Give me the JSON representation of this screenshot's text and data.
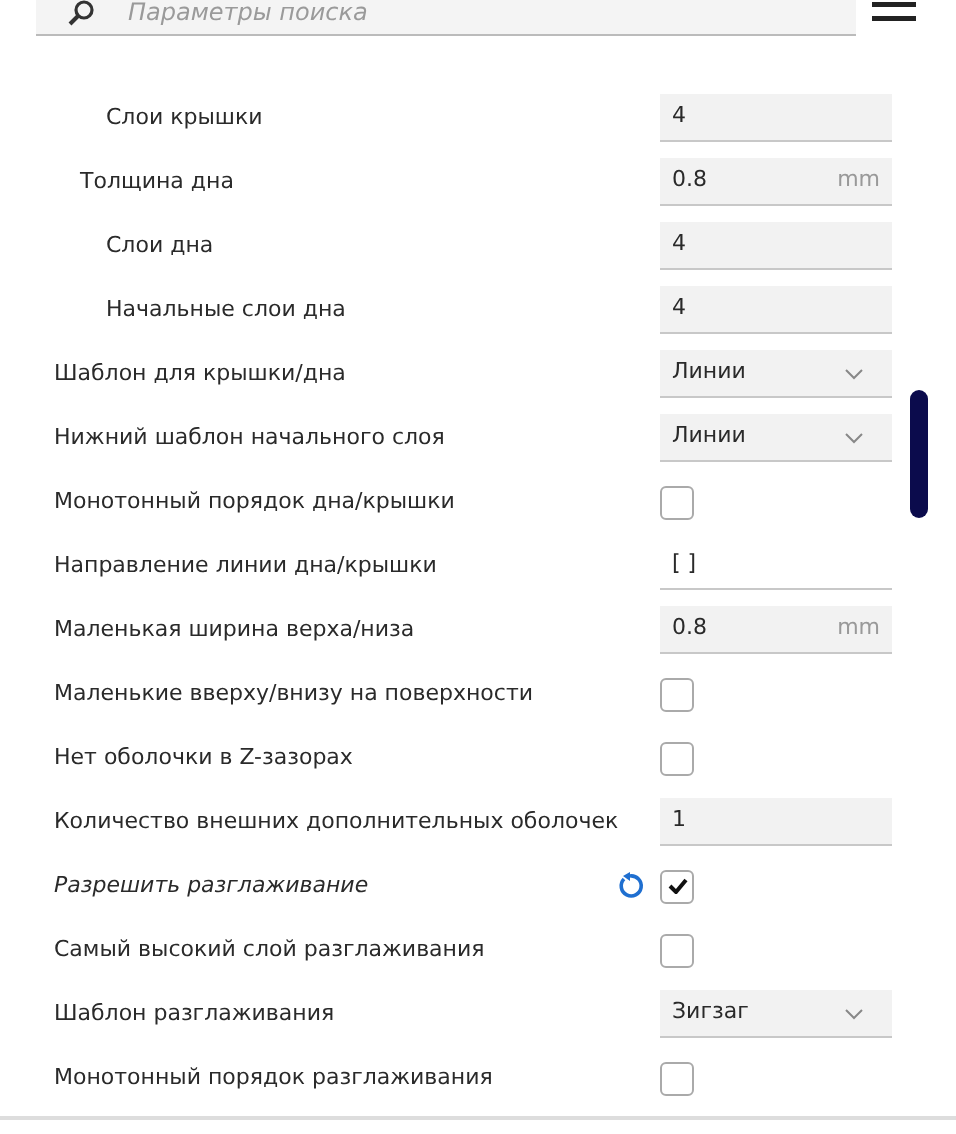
{
  "search": {
    "placeholder": "Параметры поиска"
  },
  "settings": [
    {
      "children": [
        {
          "children": [
            {
              "label": "Слои крышки",
              "kind": "number",
              "value": "4"
            }
          ]
        },
        {
          "label": "Толщина дна",
          "kind": "number",
          "value": "0.8",
          "unit": "mm",
          "children": [
            {
              "label": "Слои дна",
              "kind": "number",
              "value": "4"
            },
            {
              "label": "Начальные слои дна",
              "kind": "number",
              "value": "4"
            }
          ]
        }
      ]
    },
    {
      "label": "Шаблон для крышки/дна",
      "kind": "select",
      "value": "Линии"
    },
    {
      "label": "Нижний шаблон начального слоя",
      "kind": "select",
      "value": "Линии"
    },
    {
      "label": "Монотонный порядок дна/крышки",
      "kind": "checkbox",
      "checked": false
    },
    {
      "label": "Направление линии дна/крышки",
      "kind": "text",
      "value": "[ ]"
    },
    {
      "label": "Маленькая ширина верха/низа",
      "kind": "number",
      "value": "0.8",
      "unit": "mm"
    },
    {
      "label": "Маленькие вверху/внизу на поверхности",
      "kind": "checkbox",
      "checked": false
    },
    {
      "label": "Нет оболочки в Z-зазорах",
      "kind": "checkbox",
      "checked": false
    },
    {
      "label": "Количество внешних дополнительных оболочек",
      "kind": "number",
      "value": "1"
    },
    {
      "label": "Разрешить разглаживание",
      "kind": "checkbox",
      "checked": true,
      "modified": true
    },
    {
      "label": "Самый высокий слой разглаживания",
      "kind": "checkbox",
      "checked": false
    },
    {
      "label": "Шаблон разглаживания",
      "kind": "select",
      "value": "Зигзаг"
    },
    {
      "label": "Монотонный порядок разглаживания",
      "kind": "checkbox",
      "checked": false
    }
  ]
}
